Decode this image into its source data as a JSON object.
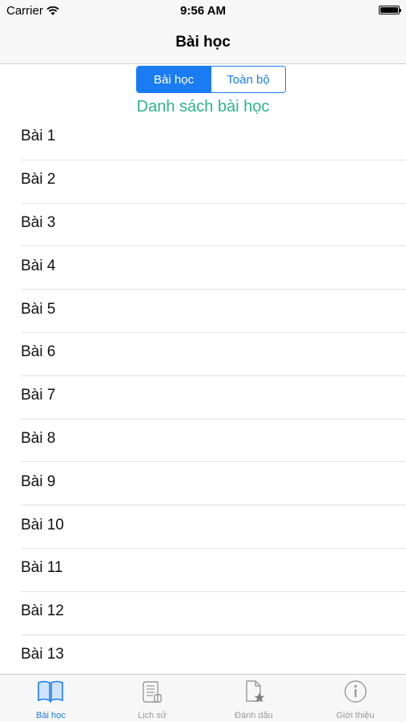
{
  "status_bar": {
    "carrier": "Carrier",
    "time": "9:56 AM",
    "battery_level": 1.0
  },
  "nav": {
    "title": "Bài học"
  },
  "segmented": {
    "options": [
      "Bài học",
      "Toàn bộ"
    ],
    "selected_index": 0
  },
  "section_title": "Danh sách bài học",
  "lessons": [
    "Bài 1",
    "Bài 2",
    "Bài 3",
    "Bài 4",
    "Bài 5",
    "Bài 6",
    "Bài 7",
    "Bài 8",
    "Bài 9",
    "Bài 10",
    "Bài 11",
    "Bài 12",
    "Bài 13"
  ],
  "tabs": [
    {
      "label": "Bài học",
      "icon": "open-book-icon",
      "active": true
    },
    {
      "label": "Lịch sử",
      "icon": "scroll-icon",
      "active": false
    },
    {
      "label": "Đánh dấu",
      "icon": "bookmark-star-icon",
      "active": false
    },
    {
      "label": "Giới thiệu",
      "icon": "info-icon",
      "active": false
    }
  ],
  "colors": {
    "accent": "#1a7cf2",
    "section_title": "#2cb487",
    "inactive_tab": "#9a9a9a"
  }
}
